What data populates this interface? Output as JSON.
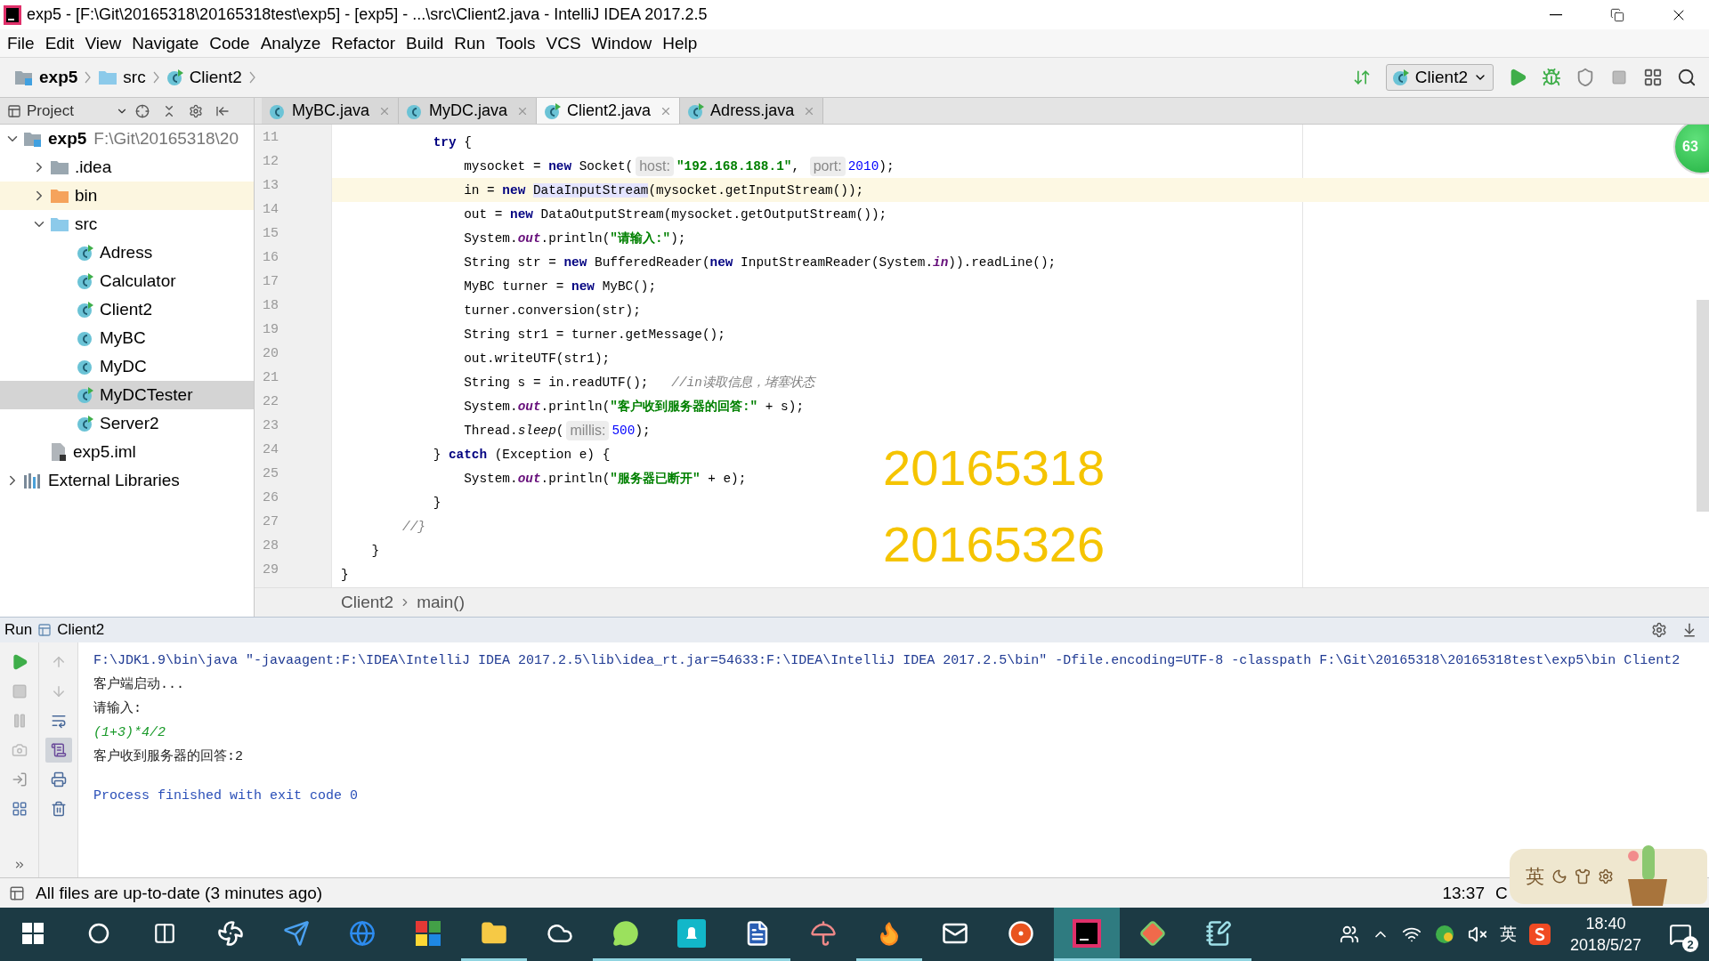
{
  "window": {
    "title": "exp5 - [F:\\Git\\20165318\\20165318test\\exp5] - [exp5] - ...\\src\\Client2.java - IntelliJ IDEA 2017.2.5"
  },
  "menu": [
    "File",
    "Edit",
    "View",
    "Navigate",
    "Code",
    "Analyze",
    "Refactor",
    "Build",
    "Run",
    "Tools",
    "VCS",
    "Window",
    "Help"
  ],
  "breadcrumbs": [
    {
      "label": "exp5",
      "kind": "module"
    },
    {
      "label": "src",
      "kind": "source-folder"
    },
    {
      "label": "Client2",
      "kind": "runnable-class"
    }
  ],
  "run_config": {
    "label": "Client2"
  },
  "project_panel": {
    "title": "Project"
  },
  "tabs": [
    {
      "label": "MyBC.java",
      "kind": "class",
      "selected": false
    },
    {
      "label": "MyDC.java",
      "kind": "class",
      "selected": false
    },
    {
      "label": "Client2.java",
      "kind": "runnable-class",
      "selected": true
    },
    {
      "label": "Adress.java",
      "kind": "runnable-class",
      "selected": false
    }
  ],
  "tree": [
    {
      "label": "exp5",
      "path": "F:\\Git\\20165318\\20",
      "kind": "module",
      "expanded": true,
      "selected": false,
      "highlighted": false,
      "children": [
        {
          "label": ".idea",
          "kind": "folder",
          "expanded": false,
          "selected": false,
          "highlighted": false
        },
        {
          "label": "bin",
          "kind": "output-folder",
          "expanded": false,
          "selected": false,
          "highlighted": true
        },
        {
          "label": "src",
          "kind": "source-folder",
          "expanded": true,
          "selected": false,
          "highlighted": false,
          "children": [
            {
              "label": "Adress",
              "kind": "runnable-class",
              "selected": false,
              "highlighted": false
            },
            {
              "label": "Calculator",
              "kind": "runnable-class",
              "selected": false,
              "highlighted": false
            },
            {
              "label": "Client2",
              "kind": "runnable-class",
              "selected": false,
              "highlighted": false
            },
            {
              "label": "MyBC",
              "kind": "class",
              "selected": false,
              "highlighted": false
            },
            {
              "label": "MyDC",
              "kind": "class",
              "selected": false,
              "highlighted": false
            },
            {
              "label": "MyDCTester",
              "kind": "runnable-class",
              "selected": true,
              "highlighted": false
            },
            {
              "label": "Server2",
              "kind": "runnable-class",
              "selected": false,
              "highlighted": false
            }
          ]
        },
        {
          "label": "exp5.iml",
          "kind": "module-file",
          "selected": false,
          "highlighted": false
        }
      ]
    },
    {
      "label": "External Libraries",
      "kind": "library",
      "expanded": false,
      "selected": false,
      "highlighted": false
    }
  ],
  "editor": {
    "lines": [
      {
        "number": "11",
        "current": false,
        "tokens": [
          {
            "kind": "keyword",
            "text": "            try"
          },
          {
            "kind": "plain",
            "text": " {"
          }
        ]
      },
      {
        "number": "12",
        "current": false,
        "tokens": [
          {
            "kind": "plain",
            "text": "                mysocket = "
          },
          {
            "kind": "keyword",
            "text": "new"
          },
          {
            "kind": "plain",
            "text": " Socket("
          },
          {
            "kind": "hint",
            "text": "host:"
          },
          {
            "kind": "string",
            "text": "\"192.168.188.1\""
          },
          {
            "kind": "plain",
            "text": ", "
          },
          {
            "kind": "hint",
            "text": "port:"
          },
          {
            "kind": "number",
            "text": "2010"
          },
          {
            "kind": "plain",
            "text": ");"
          }
        ]
      },
      {
        "number": "13",
        "current": true,
        "tokens": [
          {
            "kind": "plain",
            "text": "                in = "
          },
          {
            "kind": "keyword",
            "text": "new "
          },
          {
            "kind": "usage",
            "text": "DataInputStream"
          },
          {
            "kind": "plain",
            "text": "(mysocket.getInputStream());"
          }
        ]
      },
      {
        "number": "14",
        "current": false,
        "tokens": [
          {
            "kind": "plain",
            "text": "                out = "
          },
          {
            "kind": "keyword",
            "text": "new"
          },
          {
            "kind": "plain",
            "text": " DataOutputStream(mysocket.getOutputStream());"
          }
        ]
      },
      {
        "number": "15",
        "current": false,
        "tokens": [
          {
            "kind": "plain",
            "text": "                System."
          },
          {
            "kind": "static",
            "text": "out"
          },
          {
            "kind": "plain",
            "text": ".println("
          },
          {
            "kind": "string",
            "text": "\"请输入:\""
          },
          {
            "kind": "plain",
            "text": ");"
          }
        ]
      },
      {
        "number": "16",
        "current": false,
        "tokens": [
          {
            "kind": "plain",
            "text": "                String str = "
          },
          {
            "kind": "keyword",
            "text": "new"
          },
          {
            "kind": "plain",
            "text": " BufferedReader("
          },
          {
            "kind": "keyword",
            "text": "new"
          },
          {
            "kind": "plain",
            "text": " InputStreamReader(System."
          },
          {
            "kind": "static",
            "text": "in"
          },
          {
            "kind": "plain",
            "text": ")).readLine();"
          }
        ]
      },
      {
        "number": "17",
        "current": false,
        "tokens": [
          {
            "kind": "plain",
            "text": "                MyBC turner = "
          },
          {
            "kind": "keyword",
            "text": "new"
          },
          {
            "kind": "plain",
            "text": " MyBC();"
          }
        ]
      },
      {
        "number": "18",
        "current": false,
        "tokens": [
          {
            "kind": "plain",
            "text": "                turner.conversion(str);"
          }
        ]
      },
      {
        "number": "19",
        "current": false,
        "tokens": [
          {
            "kind": "plain",
            "text": "                String str1 = turner.getMessage();"
          }
        ]
      },
      {
        "number": "20",
        "current": false,
        "tokens": [
          {
            "kind": "plain",
            "text": "                out.writeUTF(str1);"
          }
        ]
      },
      {
        "number": "21",
        "current": false,
        "tokens": [
          {
            "kind": "plain",
            "text": "                String s = in.readUTF();   "
          },
          {
            "kind": "comment",
            "text": "//in读取信息，堵塞状态"
          }
        ]
      },
      {
        "number": "22",
        "current": false,
        "tokens": [
          {
            "kind": "plain",
            "text": "                System."
          },
          {
            "kind": "static",
            "text": "out"
          },
          {
            "kind": "plain",
            "text": ".println("
          },
          {
            "kind": "string",
            "text": "\"客户收到服务器的回答:\""
          },
          {
            "kind": "plain",
            "text": " + s);"
          }
        ]
      },
      {
        "number": "23",
        "current": false,
        "tokens": [
          {
            "kind": "plain",
            "text": "                Thread."
          },
          {
            "kind": "static-method",
            "text": "sleep"
          },
          {
            "kind": "plain",
            "text": "("
          },
          {
            "kind": "hint",
            "text": "millis:"
          },
          {
            "kind": "number",
            "text": "500"
          },
          {
            "kind": "plain",
            "text": ");"
          }
        ]
      },
      {
        "number": "24",
        "current": false,
        "tokens": [
          {
            "kind": "plain",
            "text": "            } "
          },
          {
            "kind": "keyword",
            "text": "catch"
          },
          {
            "kind": "plain",
            "text": " (Exception e) {"
          }
        ]
      },
      {
        "number": "25",
        "current": false,
        "tokens": [
          {
            "kind": "plain",
            "text": "                System."
          },
          {
            "kind": "static",
            "text": "out"
          },
          {
            "kind": "plain",
            "text": ".println("
          },
          {
            "kind": "string",
            "text": "\"服务器已断开\""
          },
          {
            "kind": "plain",
            "text": " + e);"
          }
        ]
      },
      {
        "number": "26",
        "current": false,
        "tokens": [
          {
            "kind": "plain",
            "text": "            }"
          }
        ]
      },
      {
        "number": "27",
        "current": false,
        "tokens": [
          {
            "kind": "comment",
            "text": "        //}"
          }
        ]
      },
      {
        "number": "28",
        "current": false,
        "tokens": [
          {
            "kind": "plain",
            "text": "    }"
          }
        ]
      },
      {
        "number": "29",
        "current": false,
        "tokens": [
          {
            "kind": "plain",
            "text": "}"
          }
        ]
      }
    ],
    "overlay": [
      "20165318",
      "20165326"
    ],
    "badge": "63",
    "breadcrumb": [
      "Client2",
      "main()"
    ]
  },
  "run": {
    "title": "Run",
    "config": "Client2",
    "output": [
      {
        "kind": "command",
        "text": "F:\\JDK1.9\\bin\\java \"-javaagent:F:\\IDEA\\IntelliJ IDEA 2017.2.5\\lib\\idea_rt.jar=54633:F:\\IDEA\\IntelliJ IDEA 2017.2.5\\bin\" -Dfile.encoding=UTF-8 -classpath F:\\Git\\20165318\\20165318test\\exp5\\bin Client2"
      },
      {
        "kind": "text",
        "text": "客户端启动..."
      },
      {
        "kind": "text",
        "text": "请输入:"
      },
      {
        "kind": "input",
        "text": "(1+3)*4/2"
      },
      {
        "kind": "text",
        "text": "客户收到服务器的回答:2"
      },
      {
        "kind": "exit",
        "text": "Process finished with exit code 0"
      }
    ]
  },
  "status": {
    "message": "All files are up-to-date (3 minutes ago)",
    "position": "13:37",
    "line_separator": "C"
  },
  "ime": {
    "label": "英"
  },
  "taskbar": {
    "apps": [
      {
        "kind": "start",
        "running": false,
        "selected": false
      },
      {
        "kind": "cortana",
        "running": false,
        "selected": false
      },
      {
        "kind": "task-view",
        "running": false,
        "selected": false
      },
      {
        "kind": "fan",
        "running": false,
        "selected": false
      },
      {
        "kind": "plane",
        "running": false,
        "selected": false
      },
      {
        "kind": "browser",
        "running": false,
        "selected": false
      },
      {
        "kind": "grid",
        "running": false,
        "selected": false
      },
      {
        "kind": "folder",
        "running": true,
        "selected": false
      },
      {
        "kind": "cloud",
        "running": false,
        "selected": false
      },
      {
        "kind": "chat",
        "running": true,
        "selected": false
      },
      {
        "kind": "bell",
        "running": true,
        "selected": false
      },
      {
        "kind": "document",
        "running": true,
        "selected": false
      },
      {
        "kind": "umbrella",
        "running": false,
        "selected": false
      },
      {
        "kind": "flame",
        "running": true,
        "selected": false
      },
      {
        "kind": "mail",
        "running": false,
        "selected": false
      },
      {
        "kind": "target",
        "running": false,
        "selected": false
      },
      {
        "kind": "ide",
        "running": true,
        "selected": true
      },
      {
        "kind": "diamond",
        "running": true,
        "selected": false
      },
      {
        "kind": "notebook",
        "running": true,
        "selected": false
      }
    ],
    "language": "英",
    "time": "18:40",
    "date": "2018/5/27",
    "notifications": "2"
  }
}
